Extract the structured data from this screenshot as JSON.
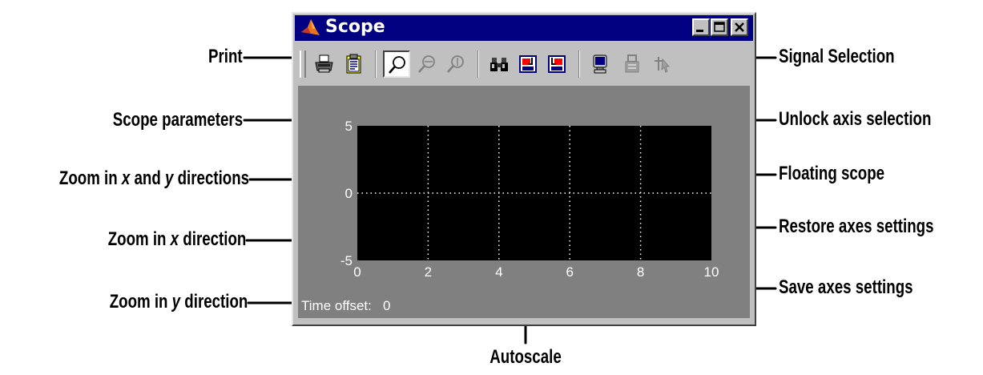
{
  "window": {
    "title": "Scope",
    "app_icon": "matlab-logo-icon",
    "controls": [
      "minimize-icon",
      "maximize-icon",
      "close-icon"
    ]
  },
  "toolbar": {
    "buttons": [
      {
        "name": "print-button",
        "icon": "printer-icon"
      },
      {
        "name": "parameters-button",
        "icon": "clipboard-icon"
      },
      {
        "name": "zoom-xy-button",
        "icon": "magnifier-icon",
        "pressed": true
      },
      {
        "name": "zoom-x-button",
        "icon": "magnifier-x-icon"
      },
      {
        "name": "zoom-y-button",
        "icon": "magnifier-y-icon"
      },
      {
        "name": "autoscale-button",
        "icon": "binoculars-icon"
      },
      {
        "name": "save-axes-button",
        "icon": "save-axes-icon"
      },
      {
        "name": "restore-axes-button",
        "icon": "restore-axes-icon"
      },
      {
        "name": "floating-scope-button",
        "icon": "monitor-icon"
      },
      {
        "name": "unlock-axis-button",
        "icon": "lock-icon",
        "disabled": true
      },
      {
        "name": "signal-selection-button",
        "icon": "signal-selection-icon",
        "disabled": true
      }
    ]
  },
  "plot": {
    "background": "#000000",
    "grid_color": "#ffffff",
    "y_ticks": [
      "5",
      "0",
      "-5"
    ],
    "x_ticks": [
      "0",
      "2",
      "4",
      "6",
      "8",
      "10"
    ],
    "ylim": [
      -5,
      5
    ],
    "xlim": [
      0,
      10
    ],
    "time_offset_label": "Time offset:",
    "time_offset_value": "0"
  },
  "callouts": {
    "print": "Print",
    "scope_parameters": "Scope parameters",
    "zoom_xy_pre": "Zoom in ",
    "zoom_xy_x": "x",
    "zoom_xy_mid": " and ",
    "zoom_xy_y": "y",
    "zoom_xy_post": " directions",
    "zoom_x_pre": "Zoom in ",
    "zoom_x_x": "x",
    "zoom_x_post": " direction",
    "zoom_y_pre": "Zoom in ",
    "zoom_y_y": "y",
    "zoom_y_post": " direction",
    "autoscale": "Autoscale",
    "signal_selection": "Signal Selection",
    "unlock_axis": "Unlock axis selection",
    "floating_scope": "Floating scope",
    "restore_axes": "Restore axes settings",
    "save_axes": "Save axes settings"
  }
}
